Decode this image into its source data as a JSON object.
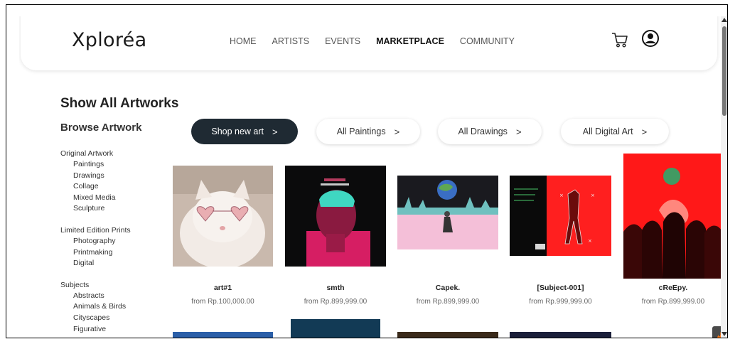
{
  "nav": {
    "logo": "Xploréa",
    "links": [
      "HOME",
      "ARTISTS",
      "EVENTS",
      "MARKETPLACE",
      "COMMUNITY"
    ],
    "active": "MARKETPLACE"
  },
  "page": {
    "title": "Show All Artworks",
    "browse_title": "Browse Artwork"
  },
  "sidebar": {
    "groups": [
      {
        "title": "Original Artwork",
        "items": [
          "Paintings",
          "Drawings",
          "Collage",
          "Mixed Media",
          "Sculpture"
        ]
      },
      {
        "title": "Limited Edition Prints",
        "items": [
          "Photography",
          "Printmaking",
          "Digital"
        ]
      },
      {
        "title": "Subjects",
        "items": [
          "Abstracts",
          "Animals & Birds",
          "Cityscapes",
          "Figurative"
        ]
      }
    ]
  },
  "filters": [
    {
      "label": "Shop new art",
      "chevron": ">"
    },
    {
      "label": "All Paintings",
      "chevron": ">"
    },
    {
      "label": "All Drawings",
      "chevron": ">"
    },
    {
      "label": "All Digital Art",
      "chevron": ">"
    }
  ],
  "artworks": [
    {
      "title": "art#1",
      "price": "from Rp.100,000.00"
    },
    {
      "title": "smth",
      "price": "from Rp.899,999.00"
    },
    {
      "title": "Capek.",
      "price": "from Rp.899,999.00"
    },
    {
      "title": "[Subject-001]",
      "price": "from Rp.999,999.00"
    },
    {
      "title": "cReEpy.",
      "price": "from Rp.899,999.00"
    }
  ],
  "icons": {
    "cart": "cart-icon",
    "user": "user-circle-icon",
    "badge": "fire-icon"
  },
  "colors": {
    "primary_button": "#1f2a33",
    "accent_red": "#ff1e1e"
  }
}
